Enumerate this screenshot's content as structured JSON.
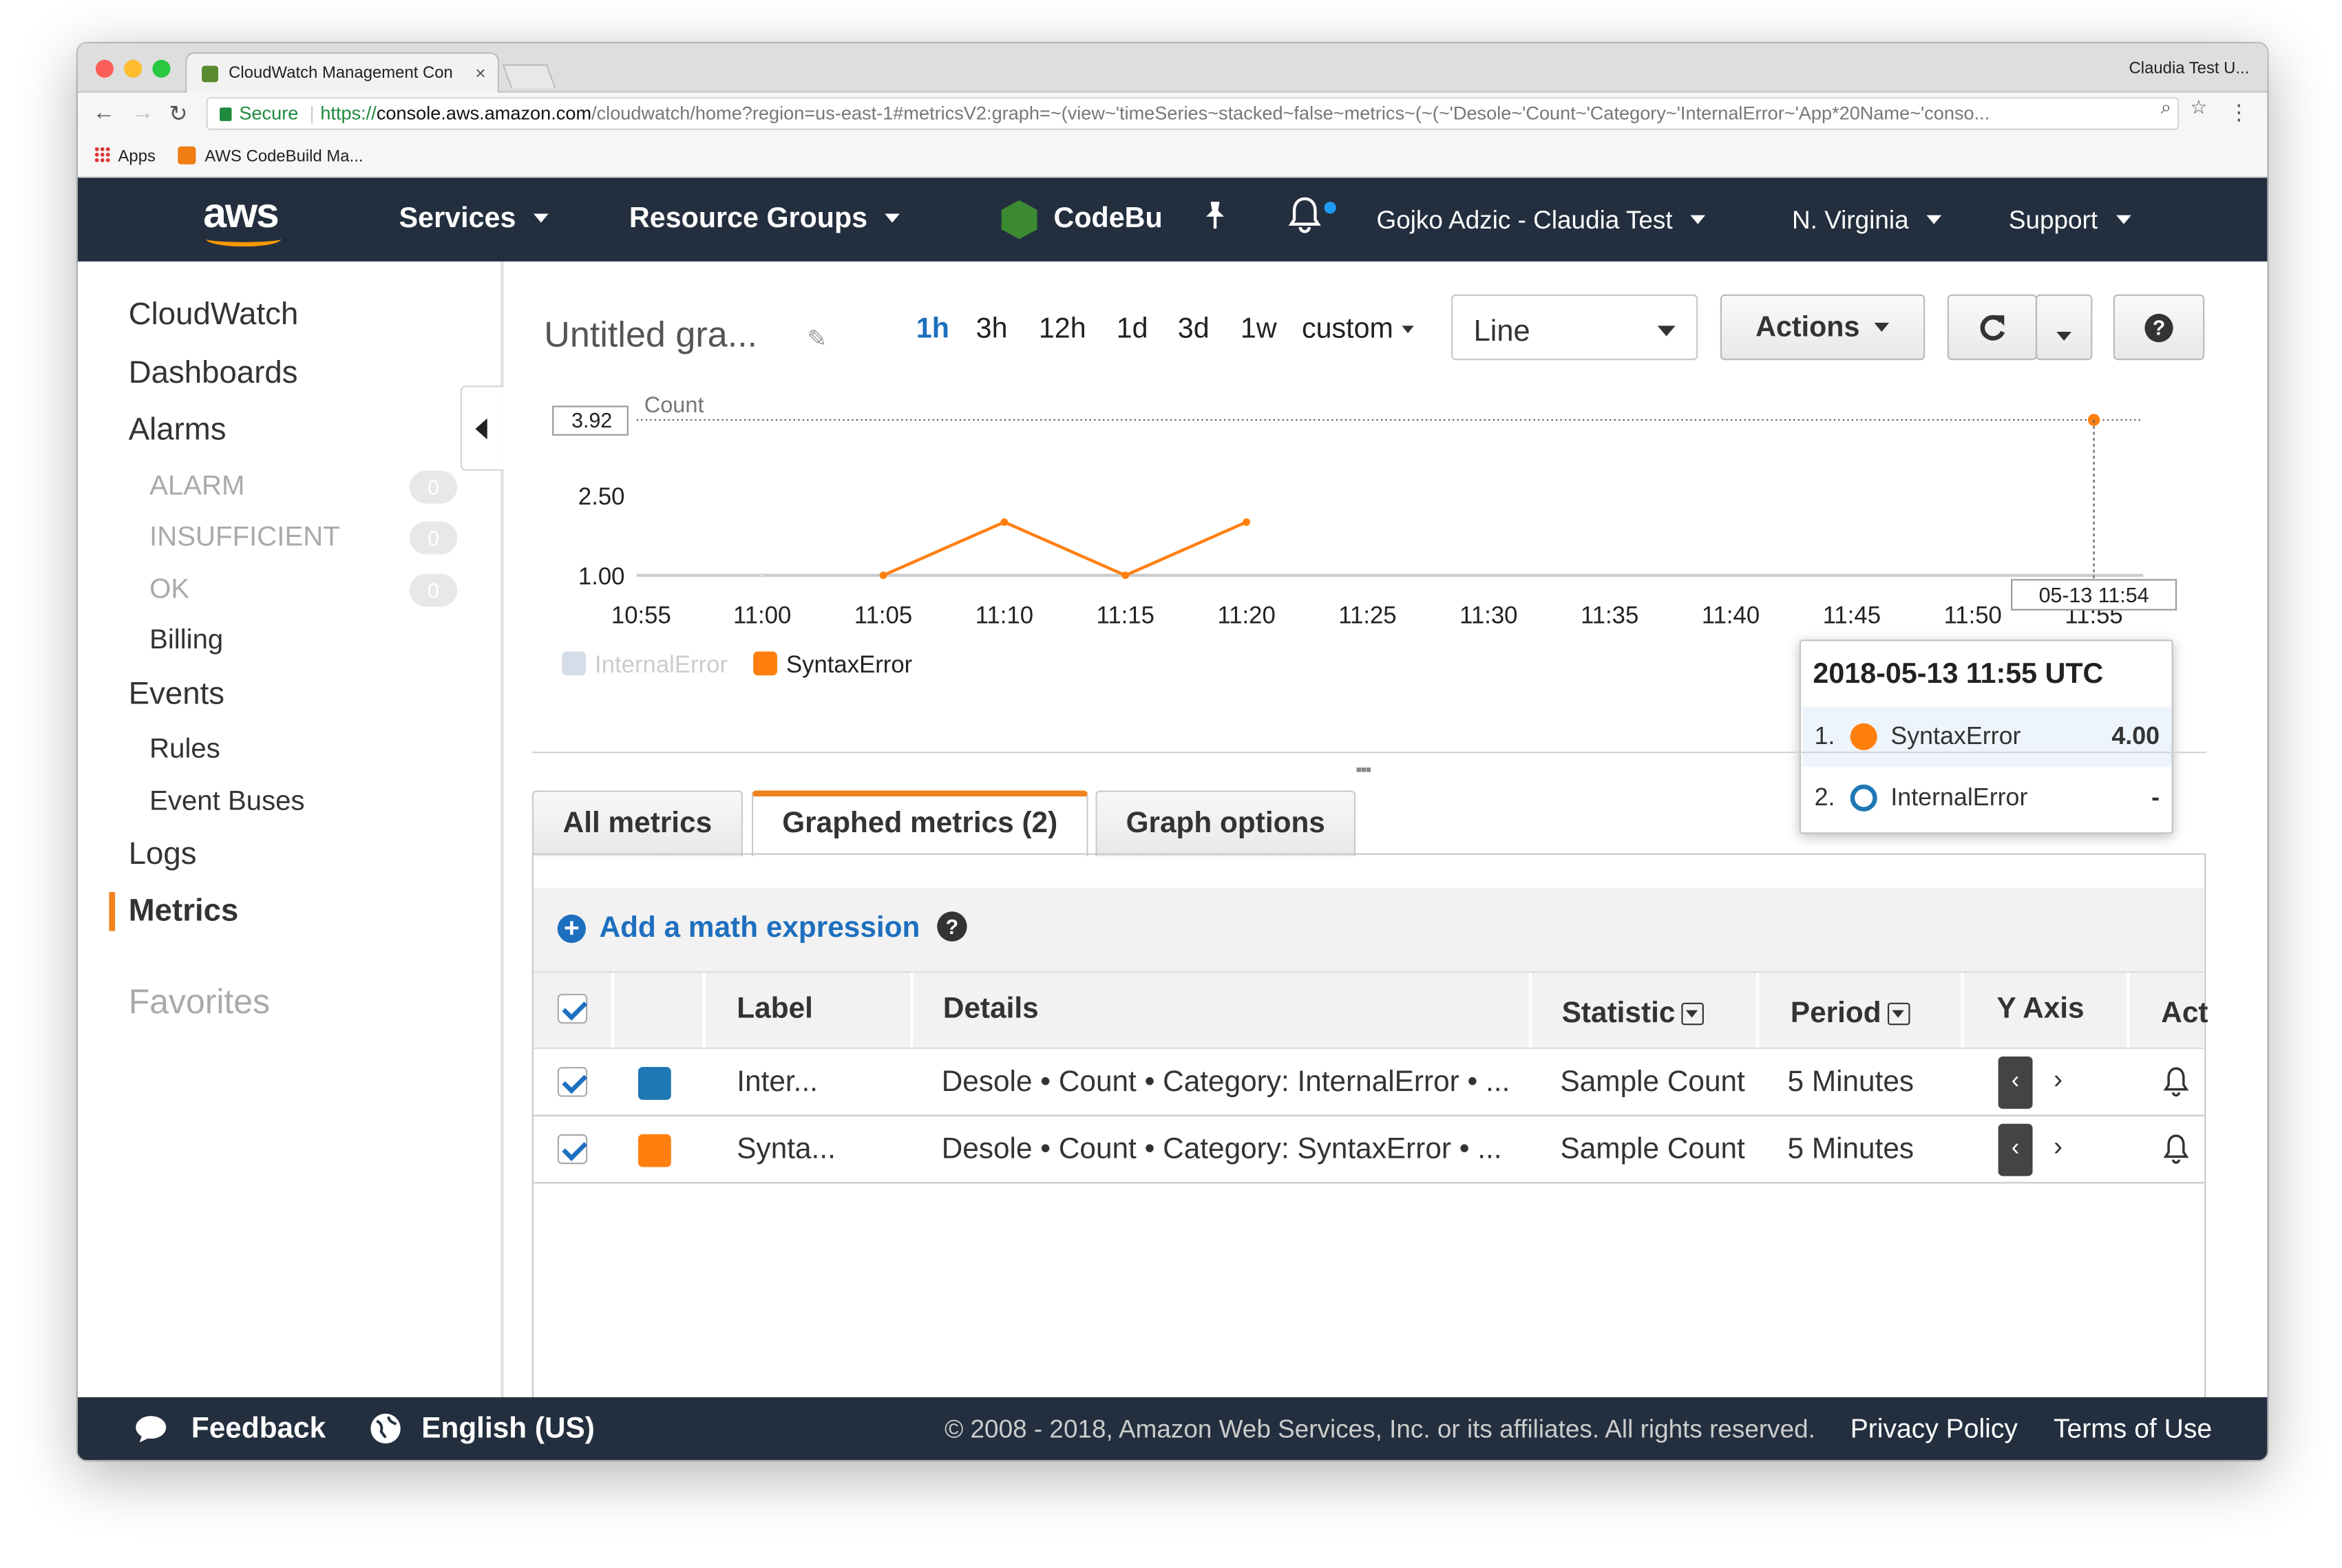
{
  "browser": {
    "tab_title": "CloudWatch Management Con",
    "tab_close": "×",
    "profile": "Claudia Test U...",
    "secure_label": "Secure",
    "url_scheme": "https://",
    "url_host": "console.aws.amazon.com",
    "url_path": "/cloudwatch/home?region=us-east-1#metricsV2:graph=~(view~'timeSeries~stacked~false~metrics~(~(~'Desole~'Count~'Category~'InternalError~'App*20Name~'conso...",
    "back": "←",
    "forward": "→",
    "reload": "↻",
    "zoom_icon": "⌕",
    "star_icon": "☆",
    "menu_icon": "⋮",
    "bookmarks": [
      {
        "label": "Apps",
        "icon": "apps-grid-icon"
      },
      {
        "label": "AWS CodeBuild Ma...",
        "icon": "codebuild-cube-icon"
      }
    ]
  },
  "aws_header": {
    "logo": "aws",
    "services": "Services",
    "resource_groups": "Resource Groups",
    "pinned_service": "CodeBu",
    "account": "Gojko Adzic - Claudia Test",
    "region": "N. Virginia",
    "support": "Support",
    "colors": {
      "bar": "#232f3e",
      "accent": "#ff9900",
      "notification_dot": "#1f9af2"
    }
  },
  "sidebar": {
    "items": [
      {
        "label": "CloudWatch",
        "level": 0
      },
      {
        "label": "Dashboards",
        "level": 0
      },
      {
        "label": "Alarms",
        "level": 0
      },
      {
        "label": "ALARM",
        "level": 1,
        "count": "0",
        "dim": true
      },
      {
        "label": "INSUFFICIENT",
        "level": 1,
        "count": "0",
        "dim": true
      },
      {
        "label": "OK",
        "level": 1,
        "count": "0",
        "dim": true
      },
      {
        "label": "Billing",
        "level": 1
      },
      {
        "label": "Events",
        "level": 0
      },
      {
        "label": "Rules",
        "level": 1
      },
      {
        "label": "Event Buses",
        "level": 1
      },
      {
        "label": "Logs",
        "level": 0
      },
      {
        "label": "Metrics",
        "level": 0,
        "active": true
      }
    ],
    "favorites": "Favorites"
  },
  "graph": {
    "title": "Untitled gra...",
    "ranges": [
      "1h",
      "3h",
      "12h",
      "1d",
      "3d",
      "1w"
    ],
    "selected_range": "1h",
    "custom": "custom",
    "view_type": "Line",
    "actions": "Actions",
    "help": "?"
  },
  "chart_data": {
    "type": "line",
    "ylabel": "Count",
    "yticks": [
      "3.92",
      "2.50",
      "1.00"
    ],
    "ylim": [
      1.0,
      3.92
    ],
    "x": [
      "10:55",
      "11:00",
      "11:05",
      "11:10",
      "11:15",
      "11:20",
      "11:25",
      "11:30",
      "11:35",
      "11:40",
      "11:45",
      "11:50",
      "11:55"
    ],
    "series": [
      {
        "name": "InternalError",
        "color": "#1f77b4",
        "hidden": true,
        "points": [
          [
            "11:00",
            1.0
          ],
          [
            "11:05",
            1.0
          ],
          [
            "11:15",
            1.0
          ]
        ]
      },
      {
        "name": "SyntaxError",
        "color": "#ff7f0e",
        "points": [
          [
            "11:05",
            1.0
          ],
          [
            "11:10",
            2.0
          ],
          [
            "11:15",
            1.0
          ],
          [
            "11:20",
            2.0
          ],
          [
            "11:55",
            4.0
          ]
        ]
      }
    ],
    "crosshair_label": "05-13 11:54",
    "grid": false,
    "legend": "bottom-left"
  },
  "tooltip": {
    "title": "2018-05-13 11:55 UTC",
    "rows": [
      {
        "n": "1.",
        "label": "SyntaxError",
        "value": "4.00"
      },
      {
        "n": "2.",
        "label": "InternalError",
        "value": "-"
      }
    ]
  },
  "panel_tabs": [
    "All metrics",
    "Graphed metrics (2)",
    "Graph options"
  ],
  "active_panel_tab": "Graphed metrics (2)",
  "math": {
    "add_label": "Add a math expression",
    "plus": "+",
    "help": "?"
  },
  "table": {
    "headers": {
      "label": "Label",
      "details": "Details",
      "statistic": "Statistic",
      "period": "Period",
      "yaxis": "Y Axis",
      "actions": "Act"
    },
    "rows": [
      {
        "label": "Inter...",
        "details": "Desole • Count • Category: InternalError • ...",
        "statistic": "Sample Count",
        "period": "5 Minutes",
        "color": "#1f77b4"
      },
      {
        "label": "Synta...",
        "details": "Desole • Count • Category: SyntaxError • ...",
        "statistic": "Sample Count",
        "period": "5 Minutes",
        "color": "#ff7f0e"
      }
    ],
    "y_left": "‹",
    "y_right": "›"
  },
  "footer": {
    "feedback": "Feedback",
    "language": "English (US)",
    "copyright": "© 2008 - 2018, Amazon Web Services, Inc. or its affiliates. All rights reserved.",
    "privacy": "Privacy Policy",
    "terms": "Terms of Use"
  }
}
